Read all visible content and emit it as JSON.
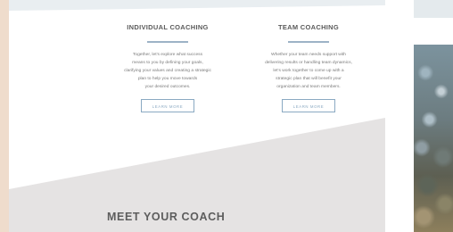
{
  "services": [
    {
      "title": "INDIVIDUAL COACHING",
      "description_lines": [
        "Together, let's explore what success",
        "means to you by defining your goals,",
        "clarifying your values and creating a strategic",
        "plan to help you move towards",
        "your desired outcomes."
      ],
      "button_label": "LEARN MORE"
    },
    {
      "title": "TEAM COACHING",
      "description_lines": [
        "Whether your team needs support with",
        "delivering results or handling team dynamics,",
        "let's work together to come up with a",
        "strategic plan that will benefit your",
        "organization and team members."
      ],
      "button_label": "LEARN MORE"
    }
  ],
  "meet_section": {
    "title": "MEET YOUR COACH"
  },
  "colors": {
    "accent": "#8aa9c2",
    "divider": "#9db3c6",
    "left_strip": "#efdccc",
    "panel_top_band": "#e9eef1",
    "lower_band": "#e5e3e3"
  }
}
